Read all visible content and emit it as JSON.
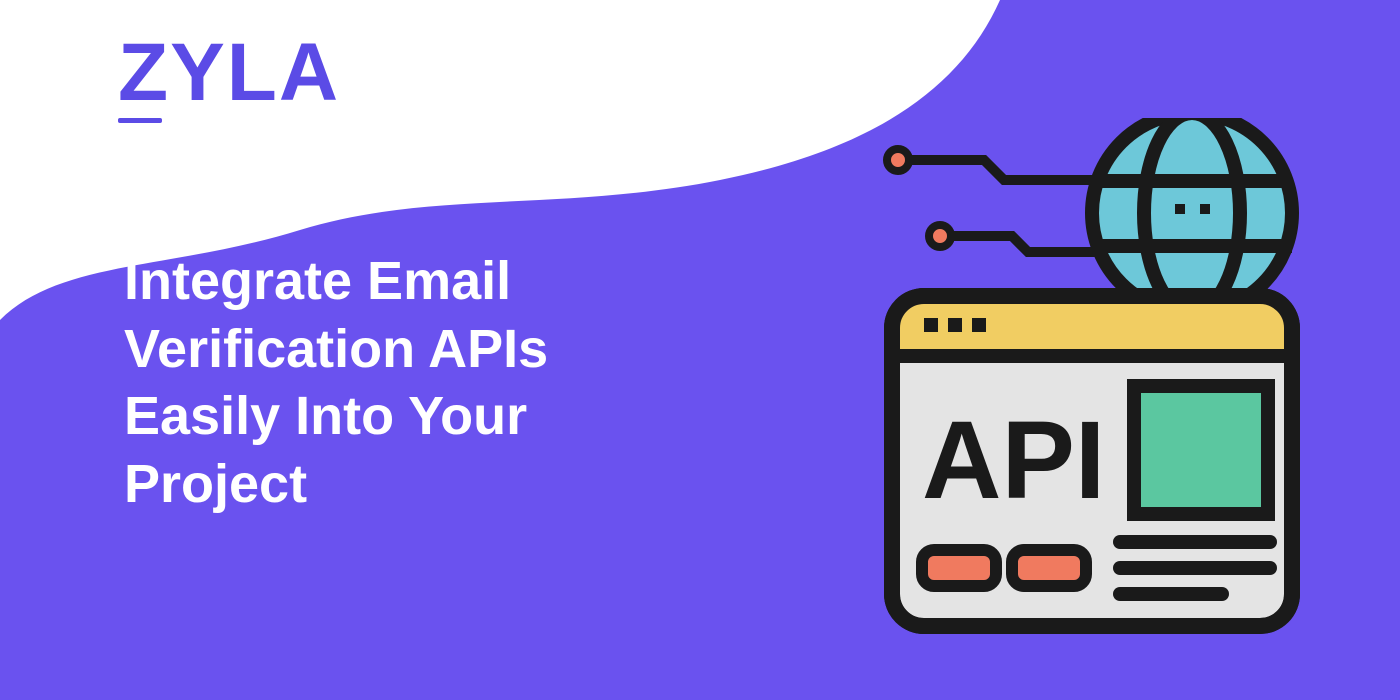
{
  "brand": {
    "logo_text": "ZYLA"
  },
  "headline": "Integrate Email Verification APIs Easily Into Your Project",
  "illustration": {
    "api_label": "API"
  },
  "colors": {
    "background": "#6a52ef",
    "logo": "#5b4be6",
    "text": "#ffffff",
    "globe": "#6dc8d9",
    "window_header": "#f1cd62",
    "window_body": "#e4e4e4",
    "accent_green": "#5bc7a0",
    "accent_coral": "#f07a5f",
    "outline": "#1a1a1a"
  }
}
